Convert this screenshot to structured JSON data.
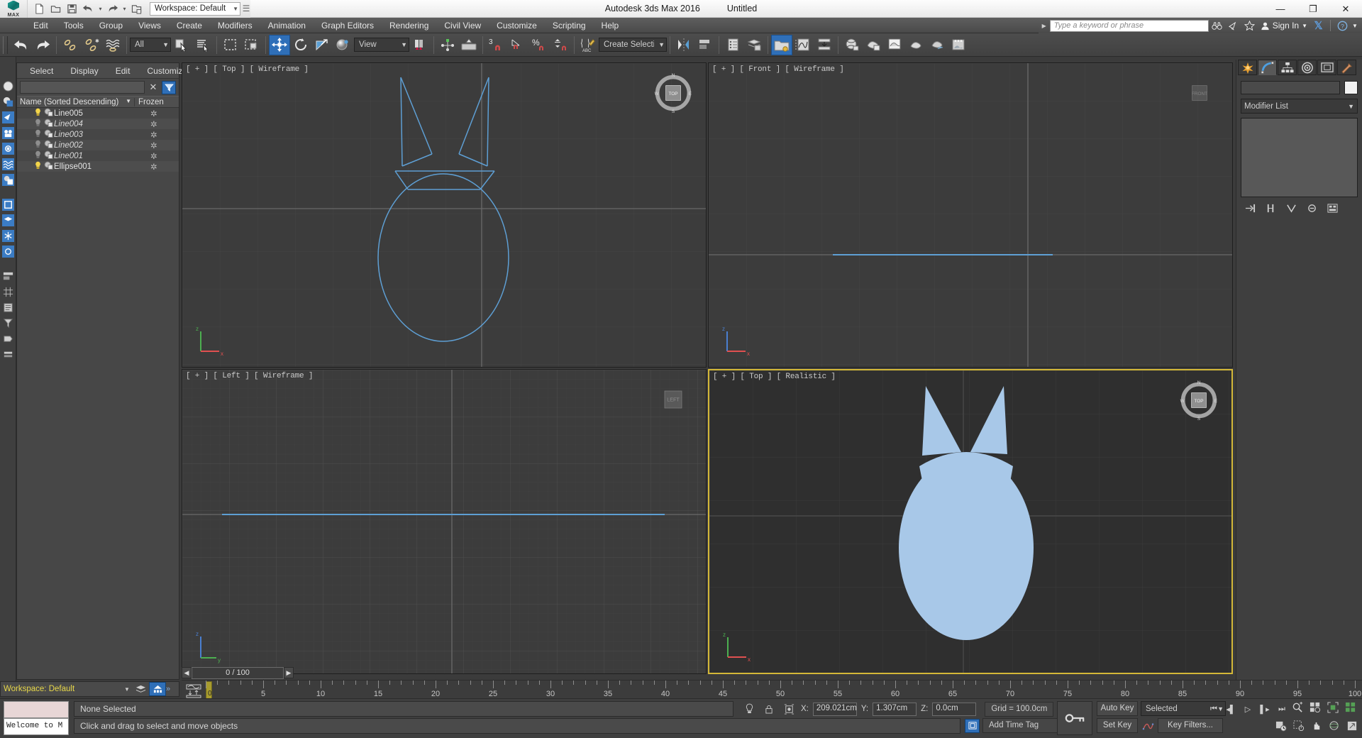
{
  "app": {
    "title": "Autodesk 3ds Max 2016",
    "document": "Untitled",
    "logo_text": "MAX"
  },
  "quick_access": {
    "workspace_label": "Workspace: Default",
    "items": [
      "new-file-icon",
      "open-file-icon",
      "save-file-icon",
      "undo-icon",
      "redo-icon",
      "project-folder-icon"
    ]
  },
  "window_controls": {
    "minimize": "—",
    "maximize": "❐",
    "close": "✕"
  },
  "menu": {
    "items": [
      {
        "label": "Edit"
      },
      {
        "label": "Tools"
      },
      {
        "label": "Group"
      },
      {
        "label": "Views"
      },
      {
        "label": "Create"
      },
      {
        "label": "Modifiers"
      },
      {
        "label": "Animation"
      },
      {
        "label": "Graph Editors"
      },
      {
        "label": "Rendering"
      },
      {
        "label": "Civil View"
      },
      {
        "label": "Customize"
      },
      {
        "label": "Scripting"
      },
      {
        "label": "Help"
      }
    ],
    "search_placeholder": "Type a keyword or phrase",
    "sign_in": "Sign In",
    "exchange_icon": "exchange-x-icon",
    "help_icon": "help-question-icon"
  },
  "toolbar": {
    "selection_filter": "All",
    "reference_coord": "View",
    "named_selection_sets": "Create Selection Se",
    "angle_snap_value": "3",
    "buttons": [
      "undo-icon",
      "redo-icon",
      "select-link-icon",
      "unlink-icon",
      "bind-to-space-warp-icon",
      "select-object-icon",
      "select-by-name-icon",
      "rectangular-select-region-icon",
      "window-crossing-icon",
      "select-and-move-icon",
      "select-and-rotate-icon",
      "select-and-scale-icon",
      "use-center-icon",
      "mirror-icon",
      "align-icon",
      "snaps-toggle-icon",
      "angle-snap-icon",
      "percent-snap-icon",
      "spinner-snap-icon",
      "edit-named-selection-sets-icon",
      "mirror-objects-icon",
      "align-objects-icon",
      "layer-explorer-icon",
      "scene-explorer-icon",
      "curve-editor-icon",
      "schematic-view-icon",
      "material-editor-icon",
      "render-setup-icon",
      "rendered-frame-window-icon",
      "render-production-icon",
      "render-iterative-icon"
    ]
  },
  "scene_explorer": {
    "menus": [
      "Select",
      "Display",
      "Edit",
      "Customize"
    ],
    "search_value": "",
    "filter_icon": "funnel-filter-icon",
    "clear_icon": "clear-x-icon",
    "columns": [
      "Name (Sorted Descending)",
      "Frozen"
    ],
    "rows": [
      {
        "name": "Line005",
        "italic": false,
        "visible": true,
        "frozen": "✲"
      },
      {
        "name": "Line004",
        "italic": true,
        "visible": false,
        "frozen": "✲"
      },
      {
        "name": "Line003",
        "italic": true,
        "visible": false,
        "frozen": "✲"
      },
      {
        "name": "Line002",
        "italic": true,
        "visible": false,
        "frozen": "✲"
      },
      {
        "name": "Line001",
        "italic": true,
        "visible": false,
        "frozen": "✲"
      },
      {
        "name": "Ellipse001",
        "italic": false,
        "visible": true,
        "frozen": "✲"
      }
    ]
  },
  "viewports": [
    {
      "id": "top-wireframe",
      "label": "[ + ] [ Top ] [ Wireframe ]",
      "view": "Top",
      "shading": "Wireframe"
    },
    {
      "id": "front-wireframe",
      "label": "[ + ] [ Front ] [ Wireframe ]",
      "view": "Front",
      "shading": "Wireframe"
    },
    {
      "id": "left-wireframe",
      "label": "[ + ] [ Left ] [ Wireframe ]",
      "view": "Left",
      "shading": "Wireframe"
    },
    {
      "id": "top-realistic",
      "label": "[ + ] [ Top ] [ Realistic ]",
      "view": "Top",
      "shading": "Realistic"
    }
  ],
  "viewcube": {
    "n": "N",
    "s": "S",
    "e": "E",
    "w": "W",
    "face": "TOP"
  },
  "colors": {
    "shape_fill": "#a8c8e8",
    "wireframe_line": "#5e9fd4",
    "accent_blue": "#2f6fb8",
    "workspace_yellow": "#e8d84a",
    "viewport_bg": "#3c3c3c",
    "viewport_realistic_bg": "#2f2f2f"
  },
  "timeline": {
    "current_frame_label": "0 / 100",
    "slider_value": "0",
    "ticks": [
      0,
      5,
      10,
      15,
      20,
      25,
      30,
      35,
      40,
      45,
      50,
      55,
      60,
      65,
      70,
      75,
      80,
      85,
      90,
      95,
      100
    ],
    "key_mode_icon": "key-mode-icon"
  },
  "status": {
    "workspace_bar": "Workspace: Default",
    "mini_listener": "Welcome to M",
    "selection": "None Selected",
    "prompt": "Click and drag to select and move objects",
    "coords": {
      "x_label": "X:",
      "x_value": "209.021cm",
      "y_label": "Y:",
      "y_value": "1.307cm",
      "z_label": "Z:",
      "z_value": "0.0cm"
    },
    "grid": "Grid = 100.0cm",
    "add_time_tag": "Add Time Tag",
    "auto_key": "Auto Key",
    "set_key": "Set Key",
    "key_filters": "Key Filters...",
    "selected_mode": "Selected",
    "spinner_value": "0"
  },
  "command_panel": {
    "tabs": [
      "create-tab-icon",
      "modify-tab-icon",
      "hierarchy-tab-icon",
      "motion-tab-icon",
      "display-tab-icon",
      "utilities-tab-icon"
    ],
    "active_tab_index": 1,
    "object_name": "",
    "modifier_list_label": "Modifier List",
    "stack_items": [],
    "stack_buttons": [
      "pin-stack-icon",
      "show-end-result-icon",
      "make-unique-icon",
      "remove-modifier-icon",
      "configure-sets-icon"
    ]
  }
}
